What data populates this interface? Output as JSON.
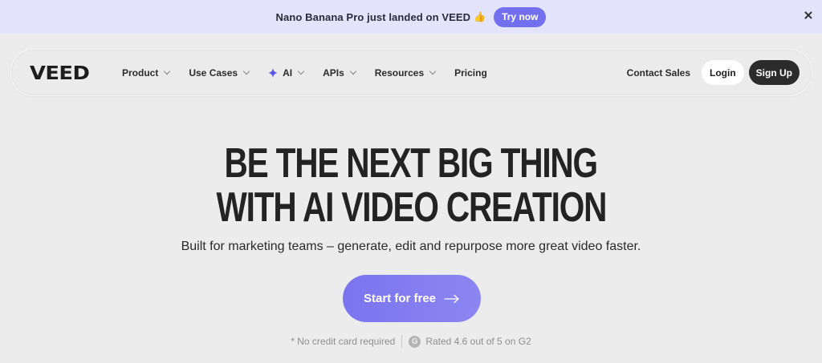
{
  "banner": {
    "text": "Nano Banana Pro just landed on VEED",
    "emoji": "👍",
    "cta_label": "Try now"
  },
  "nav": {
    "logo": "VEED",
    "items": [
      {
        "label": "Product",
        "dropdown": true
      },
      {
        "label": "Use Cases",
        "dropdown": true
      },
      {
        "label": "AI",
        "dropdown": true,
        "icon": "sparkle-icon"
      },
      {
        "label": "APIs",
        "dropdown": true
      },
      {
        "label": "Resources",
        "dropdown": true
      },
      {
        "label": "Pricing",
        "dropdown": false
      }
    ],
    "contact_label": "Contact Sales",
    "login_label": "Login",
    "signup_label": "Sign Up"
  },
  "hero": {
    "title_line1": "BE THE NEXT BIG THING",
    "title_line2": "WITH AI VIDEO CREATION",
    "subtitle": "Built for marketing teams – generate, edit and repurpose more great video faster.",
    "cta_label": "Start for free",
    "no_card": "* No credit card required",
    "rating_badge": "G",
    "rating_text": "Rated 4.6 out of 5 on G2"
  },
  "colors": {
    "accent": "#7a74ef",
    "banner_bg": "#e3e3fb",
    "page_bg": "#ececec",
    "dark": "#2b2b2b"
  }
}
